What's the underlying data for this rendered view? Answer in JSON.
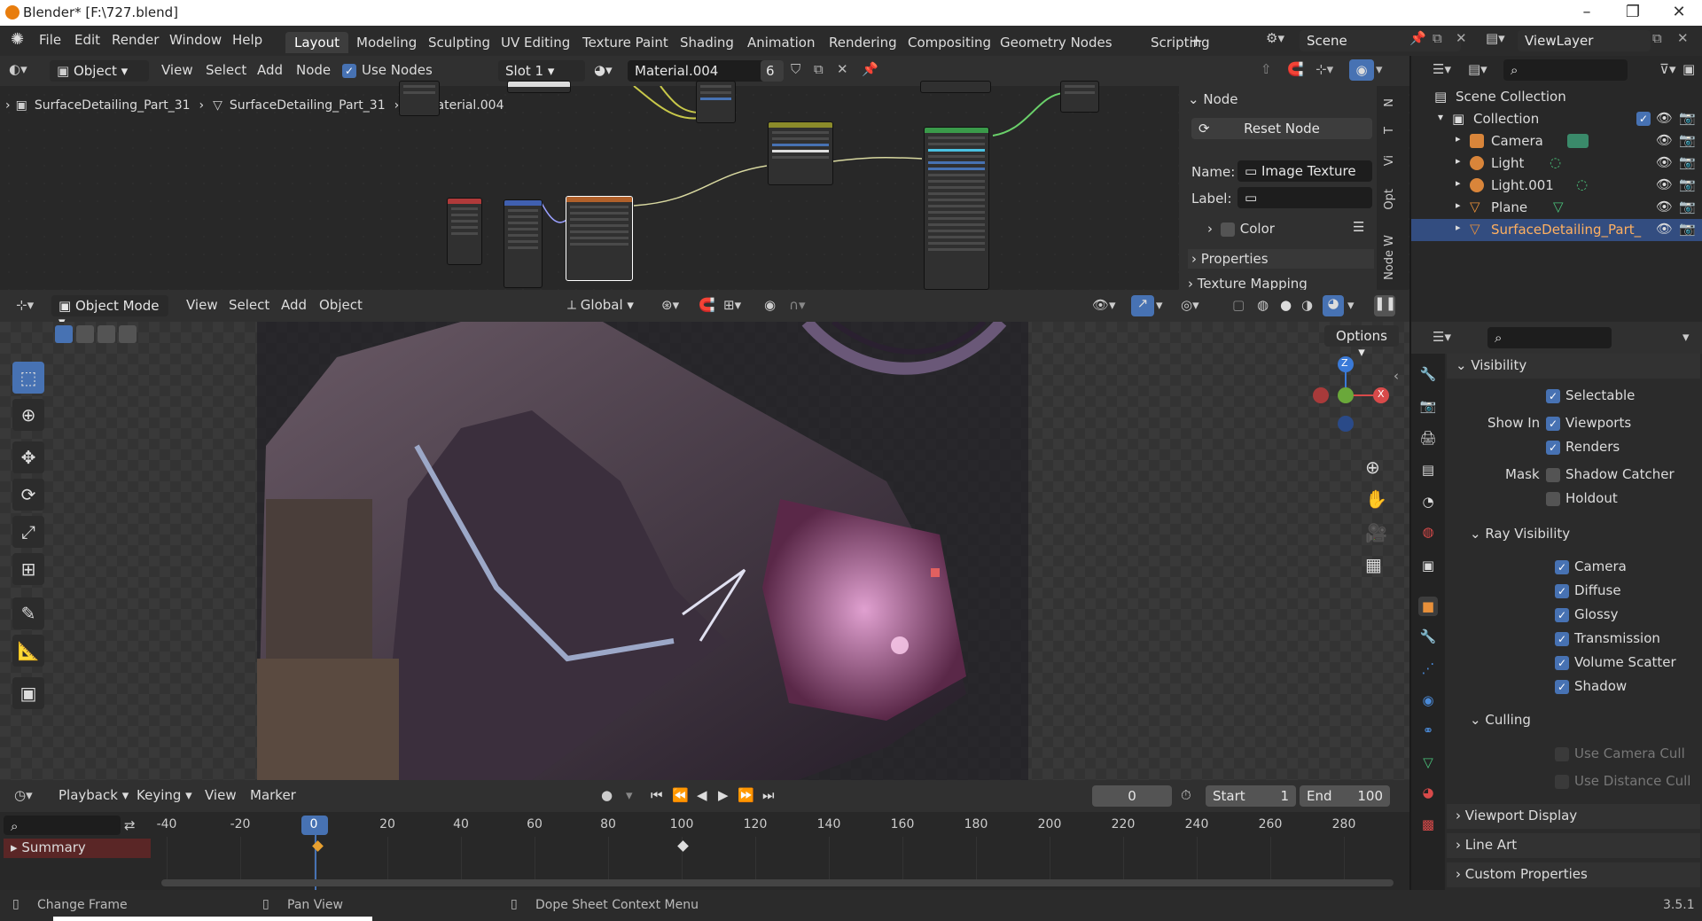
{
  "window": {
    "title": "Blender* [F:\\727.blend]"
  },
  "menu": [
    "File",
    "Edit",
    "Render",
    "Window",
    "Help"
  ],
  "workspaces": [
    "Layout",
    "Modeling",
    "Sculpting",
    "UV Editing",
    "Texture Paint",
    "Shading",
    "Animation",
    "Rendering",
    "Compositing",
    "Geometry Nodes",
    "Scripting"
  ],
  "active_workspace": "Layout",
  "scene": {
    "name": "Scene",
    "view_layer": "ViewLayer"
  },
  "node_header": {
    "mode": "Object",
    "menus": [
      "View",
      "Select",
      "Add",
      "Node"
    ],
    "use_nodes_label": "Use Nodes",
    "slot": "Slot 1",
    "material": "Material.004",
    "users": "6"
  },
  "breadcrumb": [
    "SurfaceDetailing_Part_31",
    "SurfaceDetailing_Part_31",
    "Material.004"
  ],
  "node_panel": {
    "section": "Node",
    "reset_button": "Reset Node",
    "name_label": "Name:",
    "name_value": "Image Texture",
    "label_label": "Label:",
    "label_value": "",
    "color_label": "Color",
    "properties_label": "Properties",
    "texture_mapping_label": "Texture Mapping"
  },
  "side_tabs": [
    "N",
    "T",
    "Vi",
    "Opt",
    "Node W"
  ],
  "outliner": {
    "root": "Scene Collection",
    "collection": "Collection",
    "items": [
      {
        "name": "Camera",
        "icon": "camera-icon"
      },
      {
        "name": "Light",
        "icon": "light-icon"
      },
      {
        "name": "Light.001",
        "icon": "light-icon"
      },
      {
        "name": "Plane",
        "icon": "mesh-icon"
      },
      {
        "name": "SurfaceDetailing_Part_",
        "icon": "mesh-icon",
        "selected": true
      }
    ]
  },
  "viewport_header": {
    "mode": "Object Mode",
    "menus": [
      "View",
      "Select",
      "Add",
      "Object"
    ],
    "orientation": "Global",
    "options": "Options"
  },
  "gizmo": {
    "z": "Z",
    "x": "X"
  },
  "properties": {
    "visibility": "Visibility",
    "selectable": "Selectable",
    "show_in": "Show In",
    "viewports": "Viewports",
    "renders": "Renders",
    "mask": "Mask",
    "shadow_catcher": "Shadow Catcher",
    "holdout": "Holdout",
    "ray_visibility": "Ray Visibility",
    "ray_items": [
      "Camera",
      "Diffuse",
      "Glossy",
      "Transmission",
      "Volume Scatter",
      "Shadow"
    ],
    "culling": "Culling",
    "use_camera_cull": "Use Camera Cull",
    "use_distance_cull": "Use Distance Cull",
    "viewport_display": "Viewport Display",
    "line_art": "Line Art",
    "custom_properties": "Custom Properties"
  },
  "timeline": {
    "menus": [
      "Playback",
      "Keying",
      "View",
      "Marker"
    ],
    "current_frame": "0",
    "start_label": "Start",
    "start": "1",
    "end_label": "End",
    "end": "100",
    "ticks": [
      "-40",
      "-20",
      "0",
      "20",
      "40",
      "60",
      "80",
      "100",
      "120",
      "140",
      "160",
      "180",
      "200",
      "220",
      "240",
      "260",
      "280"
    ],
    "summary": "Summary"
  },
  "status": {
    "left": "Change Frame",
    "middle": "Pan View",
    "right": "Dope Sheet Context Menu",
    "version": "3.5.1"
  }
}
